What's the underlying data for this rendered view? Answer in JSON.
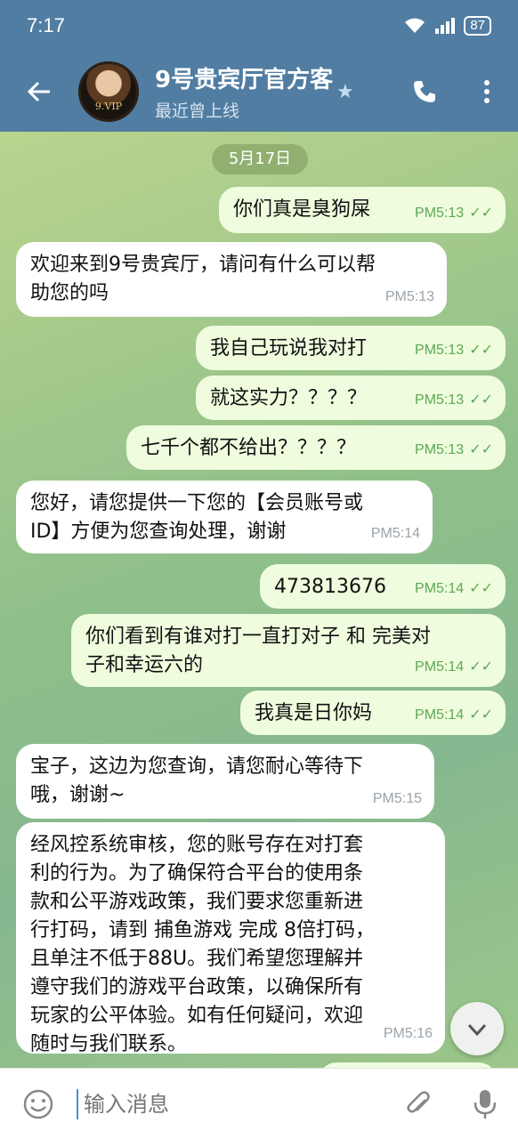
{
  "status": {
    "time": "7:17",
    "battery": "87"
  },
  "header": {
    "title": "9号贵宾厅官方客",
    "subtitle": "最近曾上线",
    "avatar_text": "9.VIP"
  },
  "chat": {
    "date": "5月17日",
    "messages": [
      {
        "dir": "out",
        "text": "你们真是臭狗屎",
        "time": "PM5:13"
      },
      {
        "dir": "in",
        "text": "欢迎来到9号贵宾厅，请问有什么可以帮\n助您的吗",
        "time": "PM5:13"
      },
      {
        "dir": "out",
        "text": "我自己玩说我对打",
        "time": "PM5:13"
      },
      {
        "dir": "out",
        "text": "就这实力？？？？",
        "time": "PM5:13"
      },
      {
        "dir": "out",
        "text": "七千个都不给出？？？？",
        "time": "PM5:13"
      },
      {
        "dir": "in",
        "text": "您好，请您提供一下您的【会员账号或\nID】方便为您查询处理，谢谢",
        "time": "PM5:14"
      },
      {
        "dir": "out",
        "text": "473813676",
        "time": "PM5:14"
      },
      {
        "dir": "out",
        "text": "你们看到有谁对打一直打对子 和 完美对\n子和幸运六的",
        "time": "PM5:14"
      },
      {
        "dir": "out",
        "text": "我真是日你妈",
        "time": "PM5:14"
      },
      {
        "dir": "in",
        "text": "宝子，这边为您查询，请您耐心等待下\n哦，谢谢~",
        "time": "PM5:15"
      },
      {
        "dir": "in",
        "text": "经风控系统审核，您的账号存在对打套\n利的行为。为了确保符合平台的使用条\n款和公平游戏政策，我们要求您重新进\n行打码，请到 捕鱼游戏 完成 8倍打码，\n且单注不低于88U。我们希望您理解并\n遵守我们的游戏平台政策，以确保所有\n玩家的公平体验。如有任何疑问，欢迎\n随时与我们联系。",
        "time": "PM5:16"
      }
    ]
  },
  "input": {
    "placeholder": "输入消息"
  },
  "colors": {
    "header": "#517da2",
    "outgoing": "#effdde",
    "incoming": "#ffffff",
    "check": "#5ca853"
  }
}
